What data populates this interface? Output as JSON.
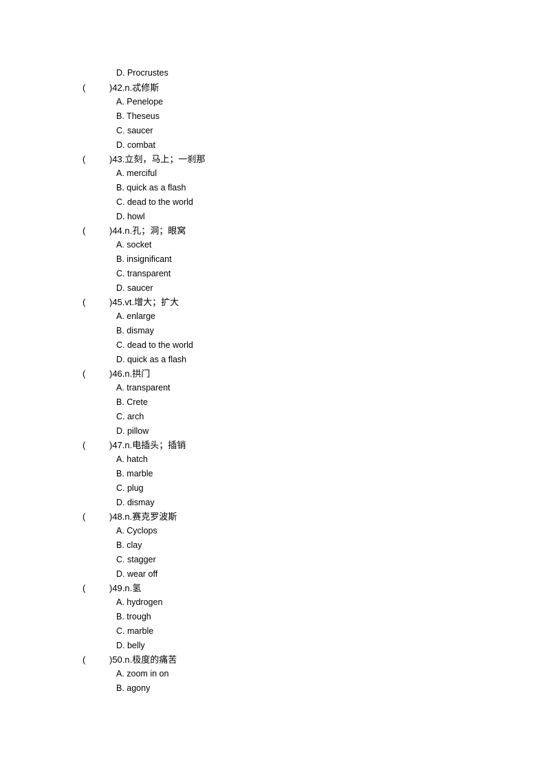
{
  "leading_option": {
    "letter": "D",
    "text": "Procrustes",
    "display": "D. Procrustes"
  },
  "questions": [
    {
      "number": "42",
      "open_paren": "(",
      "prompt": ")42.n.忒修斯",
      "options": [
        "A. Penelope",
        "B. Theseus",
        "C. saucer",
        "D. combat"
      ]
    },
    {
      "number": "43",
      "open_paren": "(",
      "prompt": ")43.立刻，马上；一刹那",
      "options": [
        "A. merciful",
        "B. quick as a flash",
        "C. dead to the world",
        "D. howl"
      ]
    },
    {
      "number": "44",
      "open_paren": "(",
      "prompt": ")44.n.孔；洞；眼窝",
      "options": [
        "A. socket",
        "B. insignificant",
        "C. transparent",
        "D. saucer"
      ]
    },
    {
      "number": "45",
      "open_paren": "(",
      "prompt": ")45.vt.增大；扩大",
      "options": [
        "A. enlarge",
        "B. dismay",
        "C. dead to the world",
        "D. quick as a flash"
      ]
    },
    {
      "number": "46",
      "open_paren": "(",
      "prompt": ")46.n.拱门",
      "options": [
        "A. transparent",
        "B. Crete",
        "C. arch",
        "D. pillow"
      ]
    },
    {
      "number": "47",
      "open_paren": "(",
      "prompt": ")47.n.电插头；插销",
      "options": [
        "A. hatch",
        "B. marble",
        "C. plug",
        "D. dismay"
      ]
    },
    {
      "number": "48",
      "open_paren": "(",
      "prompt": ")48.n.赛克罗波斯",
      "options": [
        "A. Cyclops",
        "B. clay",
        "C. stagger",
        "D. wear off"
      ]
    },
    {
      "number": "49",
      "open_paren": "(",
      "prompt": ")49.n.氢",
      "options": [
        "A. hydrogen",
        "B. trough",
        "C. marble",
        "D. belly"
      ]
    },
    {
      "number": "50",
      "open_paren": "(",
      "prompt": ")50.n.极度的痛苦",
      "options": [
        "A. zoom in on",
        "B. agony"
      ]
    }
  ]
}
